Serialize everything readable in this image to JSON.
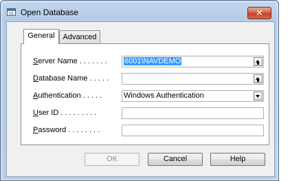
{
  "window": {
    "title": "Open Database",
    "close_label": "✕"
  },
  "tabs": [
    {
      "label": "General",
      "active": true
    },
    {
      "label": "Advanced",
      "active": false
    }
  ],
  "fields": {
    "server_name": {
      "label_mnemonic": "S",
      "label_rest": "erver Name . . . . . . .",
      "value": "6001\\NAVDEMO"
    },
    "database_name": {
      "label_mnemonic": "D",
      "label_rest": "atabase Name . . . . .",
      "value": ""
    },
    "authentication": {
      "label_mnemonic": "A",
      "label_rest": "uthentication . . . . .",
      "value": "Windows Authentication"
    },
    "user_id": {
      "label_mnemonic": "U",
      "label_rest": "ser ID . . . . . . . . .",
      "value": ""
    },
    "password": {
      "label_mnemonic": "P",
      "label_rest": "assword . . . . . . . .",
      "value": ""
    }
  },
  "buttons": {
    "ok": {
      "label": "OK",
      "enabled": false
    },
    "cancel": {
      "label": "Cancel"
    },
    "help": {
      "label": "Help"
    }
  },
  "icons": {
    "app": "database-icon",
    "lookup": "lookup-arrow-icon",
    "dropdown": "chevron-down-icon"
  },
  "colors": {
    "title_bar": "#b9cde6",
    "close_button": "#c4412b",
    "selection": "#3399ff"
  }
}
